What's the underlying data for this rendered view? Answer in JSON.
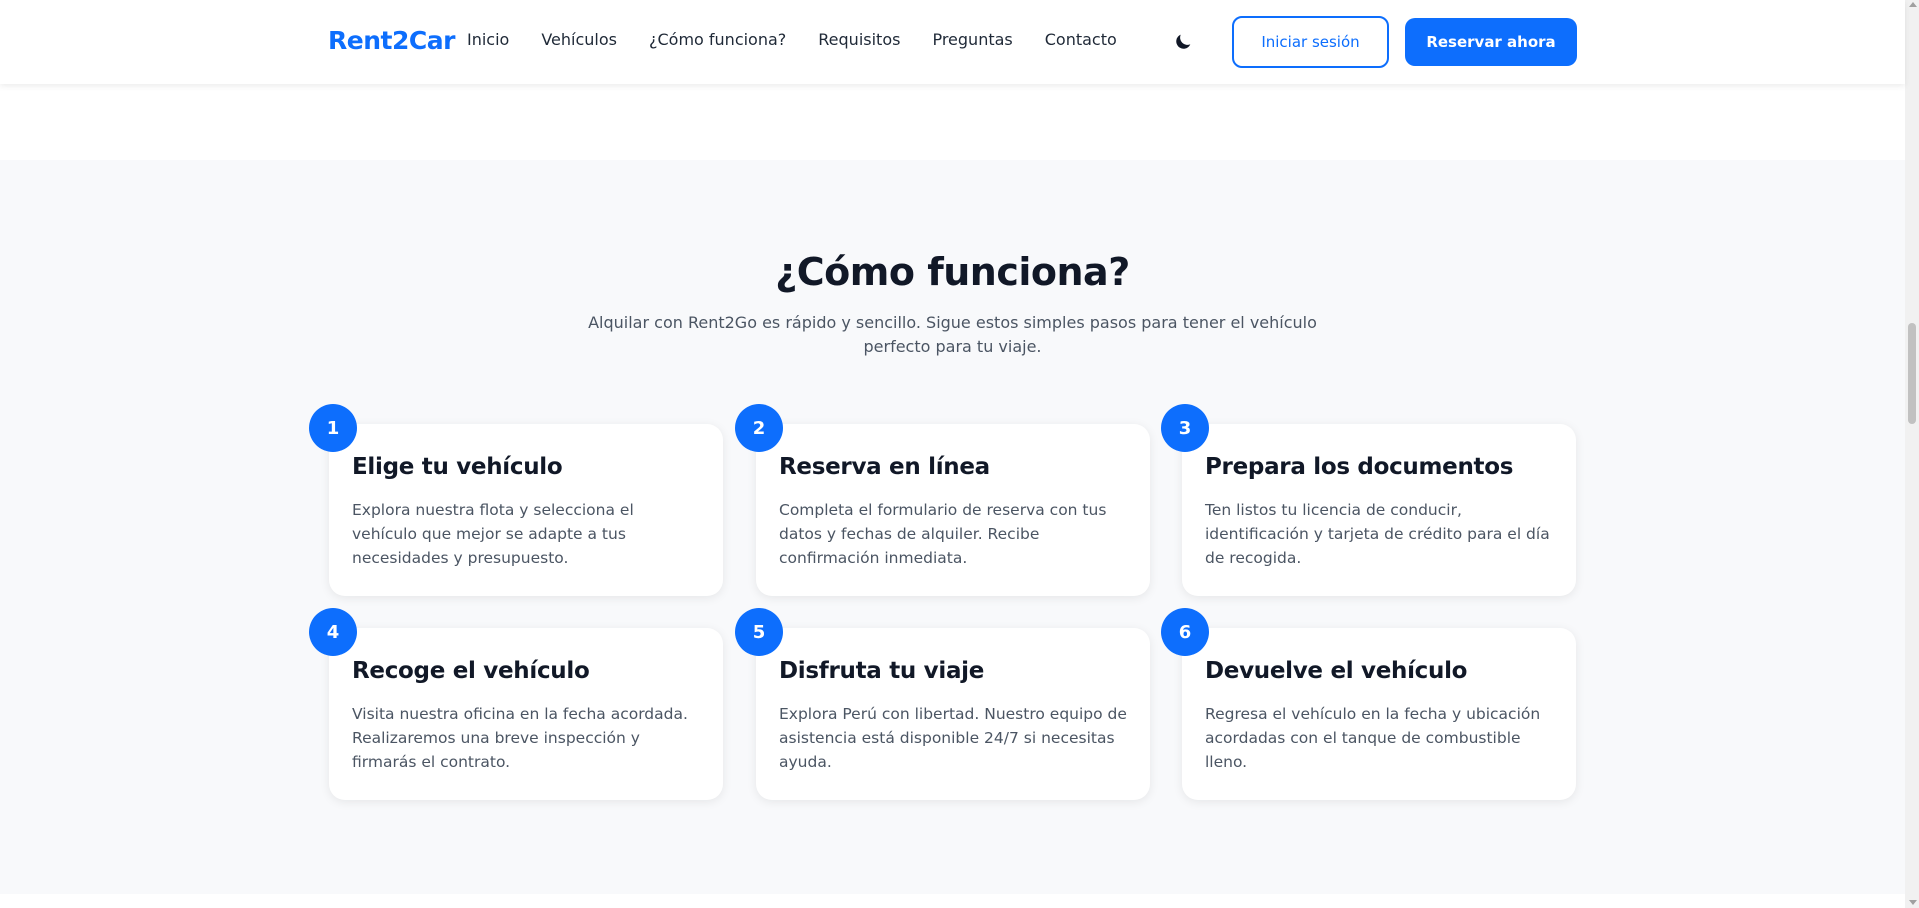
{
  "nav": {
    "logo": "Rent2Car",
    "links": [
      "Inicio",
      "Vehículos",
      "¿Cómo funciona?",
      "Requisitos",
      "Preguntas",
      "Contacto"
    ],
    "theme_toggle_icon": "moon-icon",
    "login_label": "Iniciar sesión",
    "reserve_label": "Reservar ahora"
  },
  "how_it_works": {
    "title": "¿Cómo funciona?",
    "subtitle": "Alquilar con Rent2Go es rápido y sencillo. Sigue estos simples pasos para tener el vehículo perfecto para tu viaje.",
    "steps": [
      {
        "number": "1",
        "title": "Elige tu vehículo",
        "description": "Explora nuestra flota y selecciona el vehículo que mejor se adapte a tus necesidades y presupuesto."
      },
      {
        "number": "2",
        "title": "Reserva en línea",
        "description": "Completa el formulario de reserva con tus datos y fechas de alquiler. Recibe confirmación inmediata."
      },
      {
        "number": "3",
        "title": "Prepara los documentos",
        "description": "Ten listos tu licencia de conducir, identificación y tarjeta de crédito para el día de recogida."
      },
      {
        "number": "4",
        "title": "Recoge el vehículo",
        "description": "Visita nuestra oficina en la fecha acordada. Realizaremos una breve inspección y firmarás el contrato."
      },
      {
        "number": "5",
        "title": "Disfruta tu viaje",
        "description": "Explora Perú con libertad. Nuestro equipo de asistencia está disponible 24/7 si necesitas ayuda."
      },
      {
        "number": "6",
        "title": "Devuelve el vehículo",
        "description": "Regresa el vehículo en la fecha y ubicación acordadas con el tanque de combustible lleno."
      }
    ]
  },
  "colors": {
    "accent": "#0d6efd",
    "section_bg": "#f8f9fb",
    "text_dark": "#111827",
    "text_muted": "#4b5563"
  }
}
